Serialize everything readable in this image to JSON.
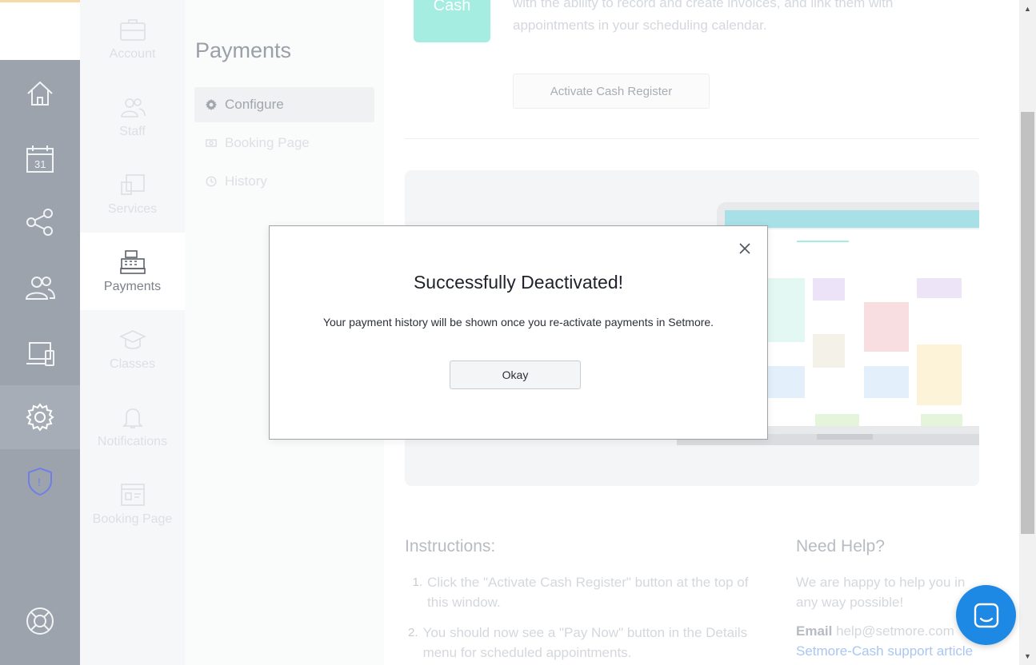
{
  "rail": {
    "items": [
      {
        "name": "home-icon"
      },
      {
        "name": "calendar-icon",
        "label": "31"
      },
      {
        "name": "share-icon"
      },
      {
        "name": "customers-icon"
      },
      {
        "name": "devices-icon"
      },
      {
        "name": "settings-icon"
      },
      {
        "name": "shield-alert-icon",
        "label": "!"
      },
      {
        "name": "help-lifebuoy-icon"
      }
    ]
  },
  "subnav": {
    "items": [
      {
        "label": "Account",
        "icon": "briefcase-icon"
      },
      {
        "label": "Staff",
        "icon": "staff-icon"
      },
      {
        "label": "Services",
        "icon": "services-icon"
      },
      {
        "label": "Payments",
        "icon": "cash-register-icon",
        "active": true
      },
      {
        "label": "Classes",
        "icon": "graduation-cap-icon"
      },
      {
        "label": "Notifications",
        "icon": "bell-icon"
      },
      {
        "label": "Booking Page",
        "icon": "booking-page-icon"
      }
    ]
  },
  "payments": {
    "title": "Payments",
    "menu": [
      {
        "label": "Configure",
        "icon": "gear-icon",
        "active": true
      },
      {
        "label": "Booking Page",
        "icon": "money-icon"
      },
      {
        "label": "History",
        "icon": "clock-icon"
      }
    ]
  },
  "main": {
    "cash_tile": "Cash",
    "intro_text": "with the ability to record and create invoices, and link them with appointments in your scheduling calendar.",
    "activate_button": "Activate Cash Register",
    "instructions": {
      "title": "Instructions:",
      "steps": [
        "Click the \"Activate Cash Register\" button at the top of this window.",
        "You should now see a \"Pay Now\" button in the Details menu for scheduled appointments."
      ]
    },
    "help": {
      "title": "Need Help?",
      "text": "We are happy to help you in any way possible!",
      "email_label": "Email",
      "email": "help@setmore.com",
      "link": "Setmore-Cash support article"
    }
  },
  "modal": {
    "title": "Successfully Deactivated!",
    "body": "Your payment history will be shown once you re-activate payments in Setmore.",
    "ok_label": "Okay"
  },
  "colors": {
    "rail": "#9ca3ad",
    "cash_tile": "#a5ede0",
    "chat": "#1e88e5",
    "shield": "#6f7fe8"
  }
}
